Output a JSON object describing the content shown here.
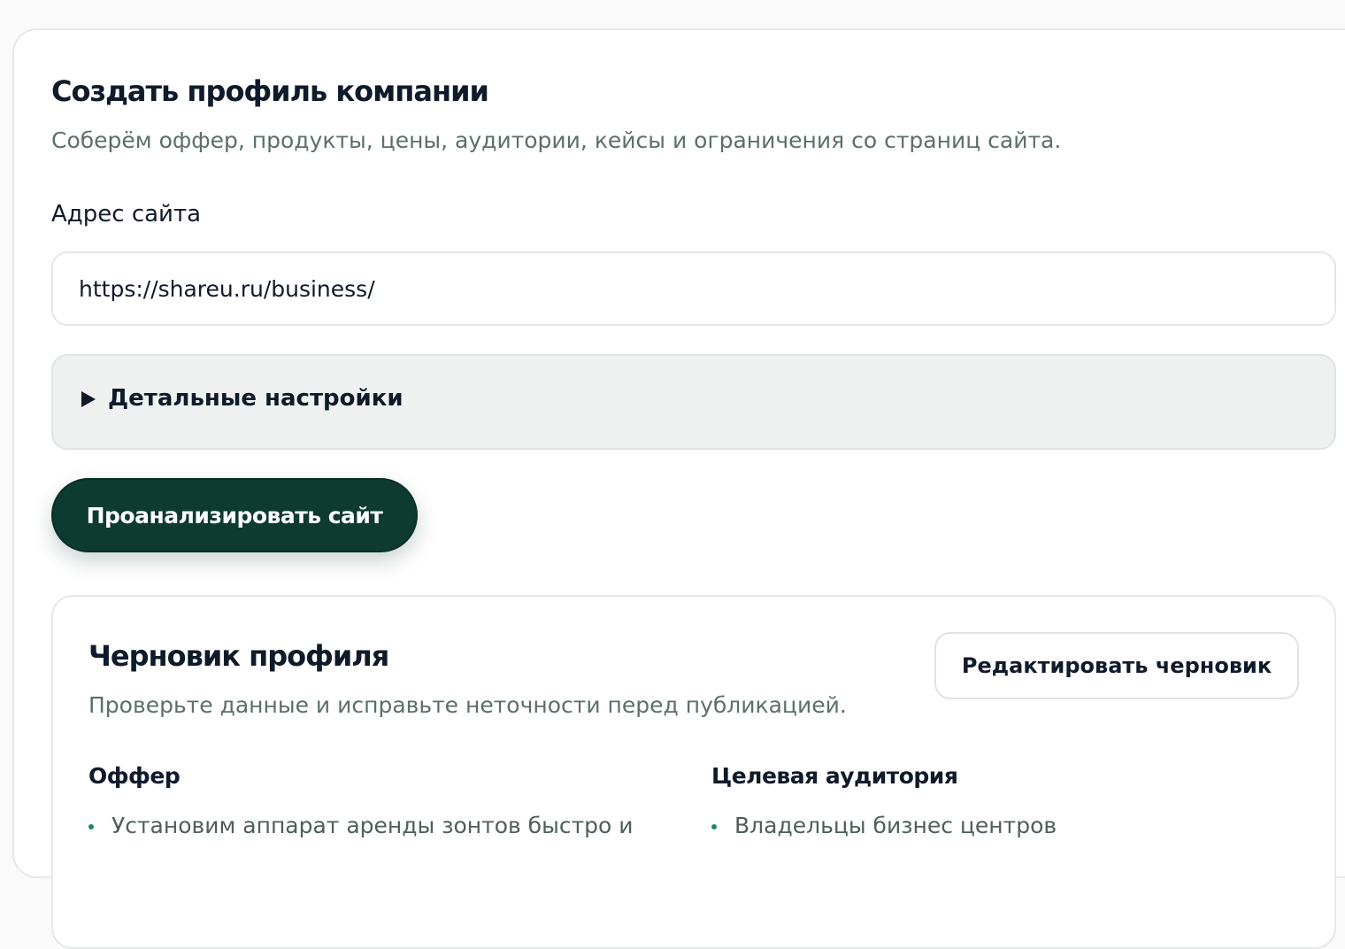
{
  "create_profile": {
    "title": "Создать профиль компании",
    "subtitle": "Соберём оффер, продукты, цены, аудитории, кейсы и ограничения со страниц сайта.",
    "site_label": "Адрес сайта",
    "site_value": "https://shareu.ru/business/",
    "details_label": "Детальные настройки",
    "analyze_button": "Проанализировать сайт"
  },
  "draft": {
    "title": "Черновик профиля",
    "subtitle": "Проверьте данные и исправьте неточности перед публикацией.",
    "edit_button": "Редактировать черновик",
    "sections": [
      {
        "heading": "Оффер",
        "items": [
          "Установим аппарат аренды зонтов быстро и"
        ]
      },
      {
        "heading": "Целевая аудитория",
        "items": [
          "Владельцы бизнес центров"
        ]
      }
    ]
  },
  "icons": {
    "details_toggle": "triangle-right-icon",
    "bullet": "bullet-dot-icon"
  },
  "colors": {
    "primary": "#0d3b30",
    "accent_bullet": "#1f8a5c",
    "muted_text": "#5c6f69",
    "details_bg": "#eef1ef"
  }
}
